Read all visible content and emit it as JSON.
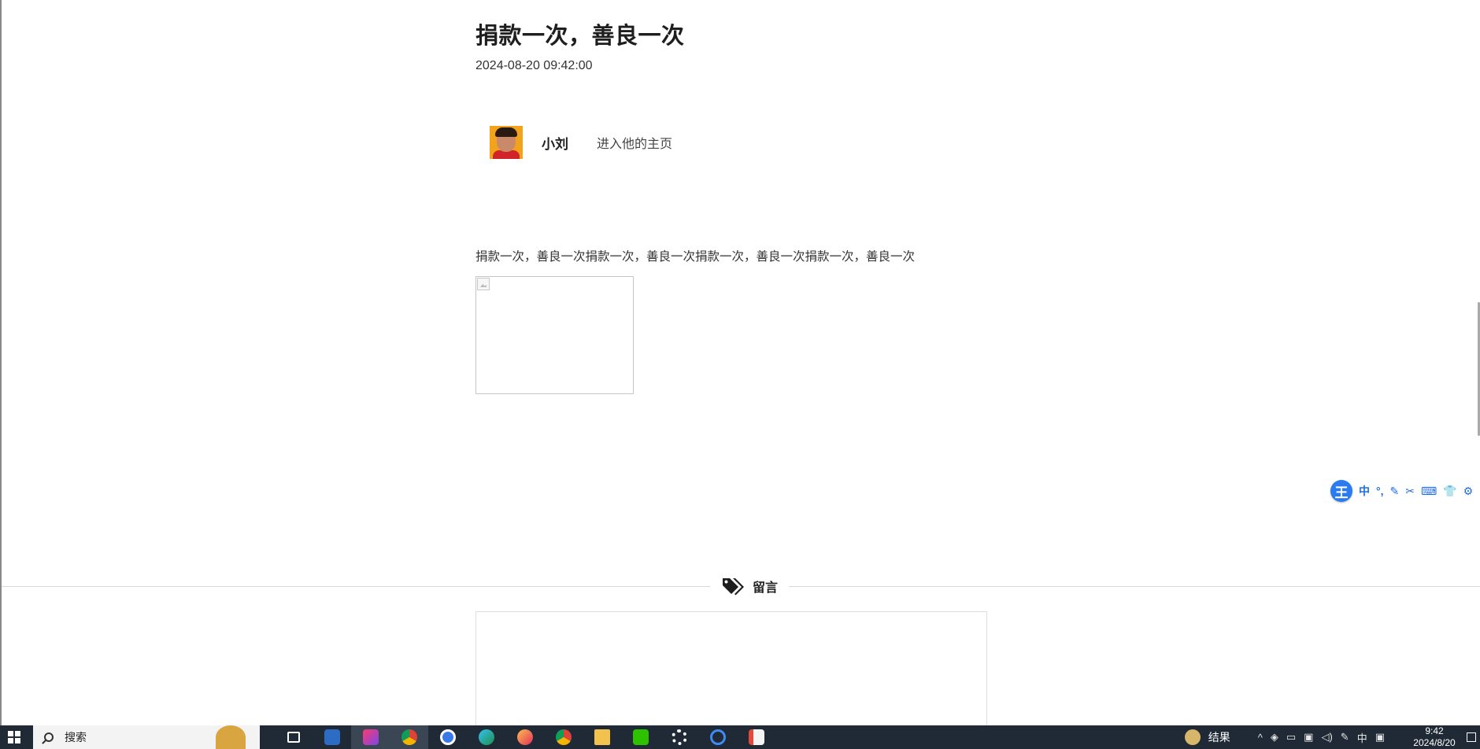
{
  "article": {
    "title": "捐款一次，善良一次",
    "date": "2024-08-20 09:42:00",
    "author": {
      "name": "小刘",
      "homepage_link": "进入他的主页"
    },
    "content": "捐款一次，善良一次捐款一次，善良一次捐款一次，善良一次捐款一次，善良一次"
  },
  "comments": {
    "heading": "留言"
  },
  "ime_toolbar": {
    "logo": "王",
    "mode": "中",
    "items": [
      "°,",
      "✎",
      "✂",
      "⌨",
      "👕",
      "⚙"
    ]
  },
  "taskbar": {
    "search_placeholder": "搜索",
    "apps": [
      "task-view",
      "outlook",
      "intellij-idea",
      "chrome",
      "app-circle",
      "edge",
      "firefox",
      "chrome-alt",
      "file-explorer",
      "wechat",
      "settings",
      "app-blue",
      "app-red"
    ],
    "weather_label": "结果",
    "ime_indicator": "中",
    "time": "9:42",
    "date": "2024/8/20"
  },
  "colors": {
    "taskbar_bg": "#1f2a36",
    "ime_accent": "#2a7bf0",
    "avatar_bg": "#f3a21b"
  }
}
